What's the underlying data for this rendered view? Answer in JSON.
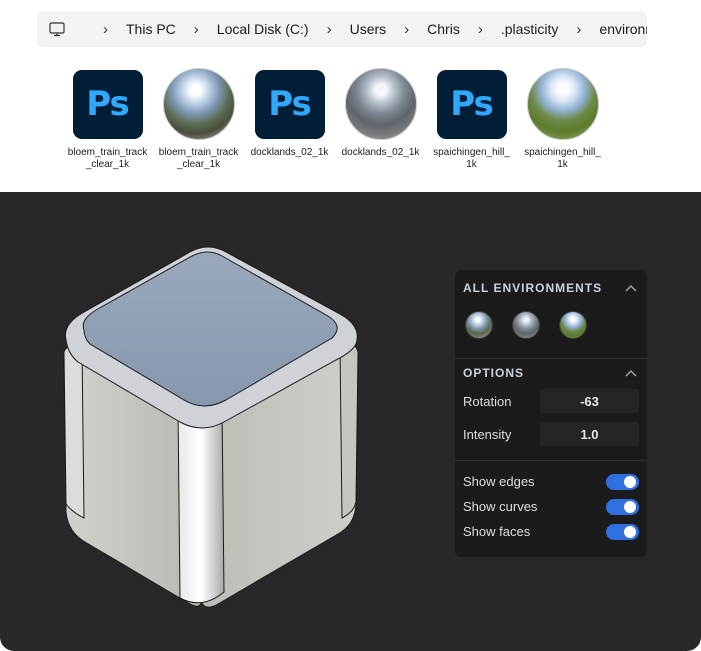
{
  "breadcrumb": {
    "icon": "computer-icon",
    "items": [
      "This PC",
      "Local Disk (C:)",
      "Users",
      "Chris",
      ".plasticity",
      "environments"
    ],
    "separator": "›"
  },
  "files": [
    {
      "name_line1": "bloem_train_track",
      "name_line2": "_clear_1k",
      "type": "photoshop"
    },
    {
      "name_line1": "bloem_train_track",
      "name_line2": "_clear_1k",
      "type": "hdri"
    },
    {
      "name_line1": "docklands_02_1k",
      "name_line2": "",
      "type": "photoshop"
    },
    {
      "name_line1": "docklands_02_1k",
      "name_line2": "",
      "type": "hdri"
    },
    {
      "name_line1": "spaichingen_hill_",
      "name_line2": "1k",
      "type": "photoshop"
    },
    {
      "name_line1": "spaichingen_hill_",
      "name_line2": "1k",
      "type": "hdri"
    }
  ],
  "ps_label": "Ps",
  "panel": {
    "environments_title": "ALL ENVIRONMENTS",
    "options_title": "OPTIONS",
    "rotation_label": "Rotation",
    "rotation_value": "-63",
    "intensity_label": "Intensity",
    "intensity_value": "1.0",
    "toggles": [
      {
        "label": "Show edges",
        "on": true
      },
      {
        "label": "Show curves",
        "on": true
      },
      {
        "label": "Show faces",
        "on": true
      }
    ]
  },
  "colors": {
    "ps_bg": "#001e36",
    "ps_text": "#31a8ff",
    "viewport_bg": "#28282a",
    "toggle_on": "#2f6fe0",
    "cube_top": "#8e9eb4",
    "cube_side": "#c2c2bd"
  }
}
